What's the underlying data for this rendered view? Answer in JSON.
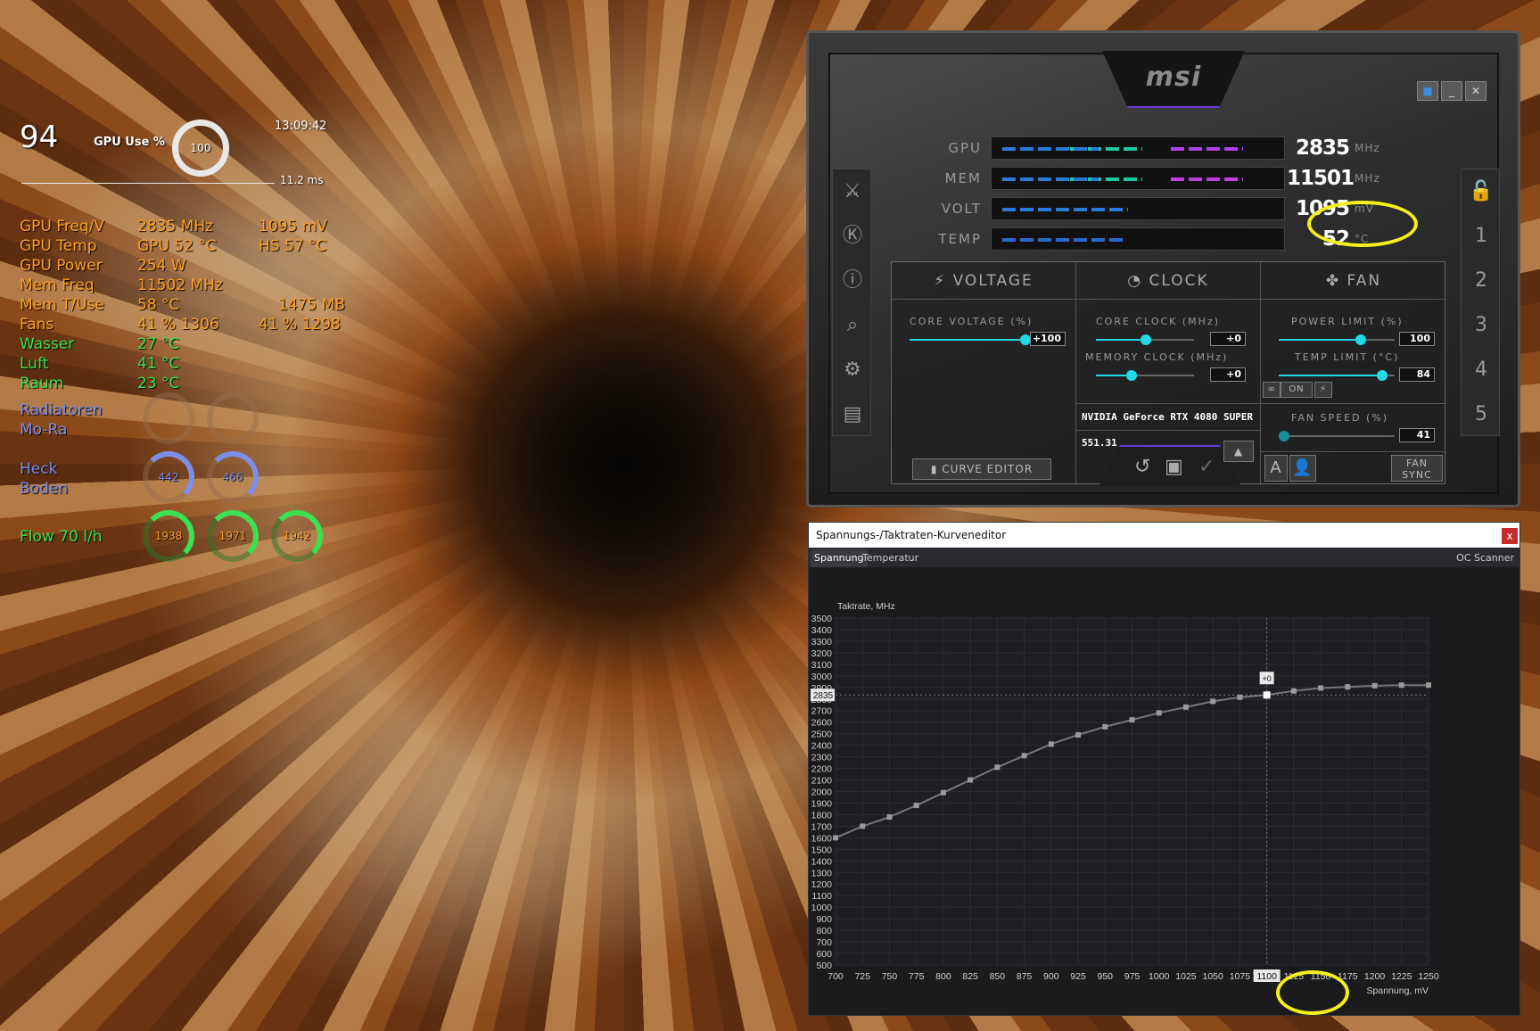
{
  "osd": {
    "fps": "94",
    "gpu_use_label": "GPU Use %",
    "gpu_use_value": "100",
    "clock_time": "13:09:42",
    "frametime": "11.2 ms",
    "rows": [
      {
        "label": "GPU Freq/V",
        "v1": "2835 MHz",
        "v2": "1095 mV"
      },
      {
        "label": "GPU Temp",
        "v1": "GPU 52 °C",
        "v2": "HS 57 °C"
      },
      {
        "label": "GPU Power",
        "v1": "254 W",
        "v2": ""
      },
      {
        "label": "Mem Freq",
        "v1": "11502 MHz",
        "v2": ""
      },
      {
        "label": "Mem T/Use",
        "v1": "58 °C",
        "v2": "1475 MB"
      },
      {
        "label": "Fans",
        "v1": "41 %  1306",
        "v2": "41 % 1298"
      },
      {
        "label": "Wasser",
        "v1": "27 °C",
        "v2": ""
      },
      {
        "label": "Luft",
        "v1": "41 °C",
        "v2": ""
      },
      {
        "label": "Raum",
        "v1": "23 °C",
        "v2": ""
      }
    ],
    "radiatoren": "Radiatoren",
    "mora": "Mo-Ra",
    "heck": "Heck",
    "boden": "Boden",
    "heck_rpm": "442",
    "boden_rpm": "466",
    "flow_label": "Flow 70 l/h",
    "flow_values": [
      "1938",
      "1971",
      "1942"
    ]
  },
  "afterburner": {
    "logo": "msi",
    "monitors": [
      {
        "label": "GPU",
        "value": "2835",
        "unit": "MHz",
        "fill": 0.9,
        "color": "#b040e8"
      },
      {
        "label": "MEM",
        "value": "11501",
        "unit": "MHz",
        "fill": 0.9,
        "color": "#c040e0"
      },
      {
        "label": "VOLT",
        "value": "1095",
        "unit": "mV",
        "fill": 0.47,
        "color": "#2a7ad8"
      },
      {
        "label": "TEMP",
        "value": "52",
        "unit": "°C",
        "fill": 0.45,
        "color": "#2a6ad0"
      }
    ],
    "voltage_header": "VOLTAGE",
    "clock_header": "CLOCK",
    "fan_header": "FAN",
    "core_voltage_label": "CORE VOLTAGE  (%)",
    "core_voltage_value": "+100",
    "core_clock_label": "CORE CLOCK (MHz)",
    "core_clock_value": "+0",
    "memory_clock_label": "MEMORY CLOCK (MHz)",
    "memory_clock_value": "+0",
    "power_limit_label": "POWER LIMIT (%)",
    "power_limit_value": "100",
    "temp_limit_label": "TEMP LIMIT (°C)",
    "temp_limit_value": "84",
    "link_on": "ON",
    "fan_speed_label": "FAN SPEED (%)",
    "fan_speed_value": "41",
    "gpu_name": "NVIDIA GeForce RTX 4080 SUPER",
    "driver": "551.31",
    "curve_editor": "CURVE EDITOR",
    "fan_sync": "FAN SYNC",
    "profiles": [
      "1",
      "2",
      "3",
      "4",
      "5"
    ],
    "auto_label": "A"
  },
  "curve_editor": {
    "title": "Spannungs-/Taktraten-Kurveneditor",
    "close": "x",
    "tab_voltage": "Spannung",
    "tab_temp": "Temperatur",
    "oc_scanner": "OC Scanner",
    "point_offset": "+0",
    "current_clock_marker": "2835",
    "current_voltage_marker": "1100"
  },
  "chart_data": {
    "type": "line",
    "title": "",
    "xlabel": "Spannung, mV",
    "ylabel": "Taktrate, MHz",
    "xlim": [
      700,
      1250
    ],
    "ylim": [
      500,
      3500
    ],
    "x_ticks": [
      700,
      725,
      750,
      775,
      800,
      825,
      850,
      875,
      900,
      925,
      950,
      975,
      1000,
      1025,
      1050,
      1075,
      1100,
      1125,
      1150,
      1175,
      1200,
      1225,
      1250
    ],
    "y_ticks": [
      500,
      600,
      700,
      800,
      900,
      1000,
      1100,
      1200,
      1300,
      1400,
      1500,
      1600,
      1700,
      1800,
      1900,
      2000,
      2100,
      2200,
      2300,
      2400,
      2500,
      2600,
      2700,
      2800,
      2900,
      3000,
      3100,
      3200,
      3300,
      3400,
      3500
    ],
    "series": [
      {
        "x": [
          700,
          725,
          750,
          775,
          800,
          825,
          850,
          875,
          900,
          925,
          950,
          975,
          1000,
          1025,
          1050,
          1075,
          1100,
          1125,
          1150,
          1175,
          1200,
          1225,
          1250
        ],
        "values": [
          1600,
          1700,
          1780,
          1880,
          1990,
          2100,
          2210,
          2310,
          2410,
          2490,
          2560,
          2620,
          2680,
          2730,
          2780,
          2815,
          2835,
          2870,
          2895,
          2905,
          2915,
          2920,
          2920
        ]
      }
    ],
    "selected_point": {
      "x": 1100,
      "y": 2835
    },
    "grid": true
  }
}
